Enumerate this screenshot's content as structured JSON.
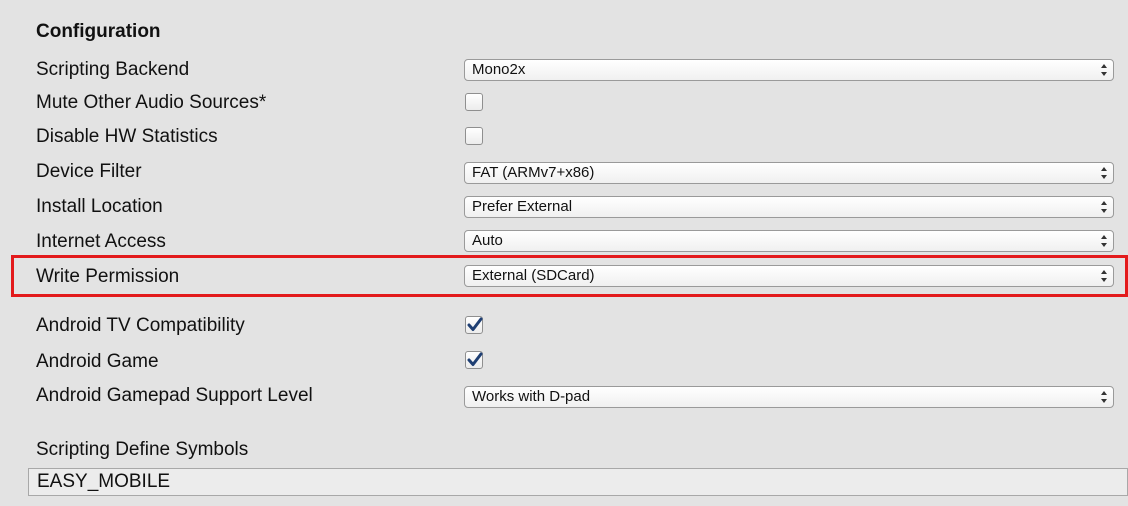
{
  "section": {
    "title": "Configuration"
  },
  "rows": {
    "scripting_backend": {
      "label": "Scripting Backend",
      "value": "Mono2x"
    },
    "mute_other_audio": {
      "label": "Mute Other Audio Sources*",
      "checked": false
    },
    "disable_hw_statistics": {
      "label": "Disable HW Statistics",
      "checked": false
    },
    "device_filter": {
      "label": "Device Filter",
      "value": "FAT (ARMv7+x86)"
    },
    "install_location": {
      "label": "Install Location",
      "value": "Prefer External"
    },
    "internet_access": {
      "label": "Internet Access",
      "value": "Auto"
    },
    "write_permission": {
      "label": "Write Permission",
      "value": "External (SDCard)"
    },
    "android_tv_compat": {
      "label": "Android TV Compatibility",
      "checked": true
    },
    "android_game": {
      "label": "Android Game",
      "checked": true
    },
    "gamepad_support": {
      "label": "Android Gamepad Support Level",
      "value": "Works with D-pad"
    }
  },
  "define_symbols": {
    "label": "Scripting Define Symbols",
    "value": "EASY_MOBILE"
  },
  "colors": {
    "highlight": "#e31a1c",
    "checkmark": "#1f3f73"
  }
}
